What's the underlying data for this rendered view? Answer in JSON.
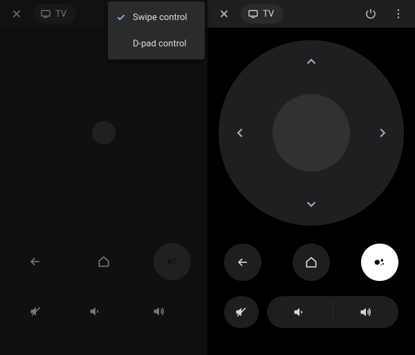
{
  "left": {
    "topbar": {
      "device_label": "TV"
    },
    "menu": {
      "swipe_label": "Swipe control",
      "dpad_label": "D-pad control",
      "selected": "swipe"
    }
  },
  "right": {
    "topbar": {
      "device_label": "TV"
    }
  },
  "icons": {
    "close": "close-icon",
    "tv": "tv-icon",
    "power": "power-icon",
    "more": "more-vert-icon",
    "check": "check-icon",
    "back": "back-arrow-icon",
    "home": "home-icon",
    "assistant": "assistant-icon",
    "mute": "mute-icon",
    "vol_down": "volume-down-icon",
    "vol_up": "volume-up-icon",
    "chev_up": "chevron-up-icon",
    "chev_down": "chevron-down-icon",
    "chev_left": "chevron-left-icon",
    "chev_right": "chevron-right-icon"
  }
}
